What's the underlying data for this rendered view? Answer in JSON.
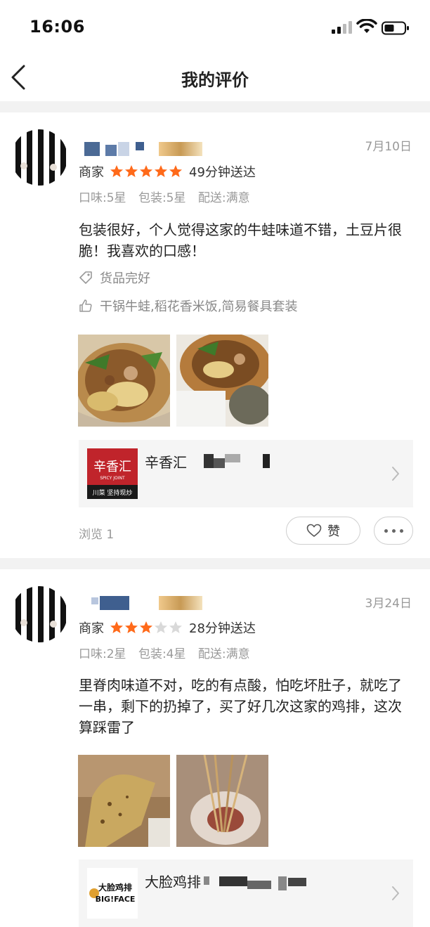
{
  "status_bar": {
    "time": "16:06"
  },
  "header": {
    "title": "我的评价"
  },
  "colors": {
    "star_active": "#ff6a1a",
    "star_inactive": "#d9d9d9"
  },
  "reviews": [
    {
      "date": "7月10日",
      "merchant_label": "商家",
      "rating": 5,
      "delivery": "49分钟送达",
      "sub_ratings": [
        "口味:5星",
        "包装:5星",
        "配送:满意"
      ],
      "content": "包装很好，个人觉得这家的牛蛙味道不错，土豆片很脆！我喜欢的口感！",
      "tags": [
        {
          "icon": "tag-icon",
          "text": "货品完好"
        },
        {
          "icon": "thumbs-up-icon",
          "text": "干锅牛蛙,稻花香米饭,简易餐具套装"
        }
      ],
      "shop": {
        "name": "辛香汇",
        "logo_main": "辛香汇",
        "logo_sub": "SPICY JOINT",
        "logo_bottom": "川菜 坚持现炒"
      },
      "views": "浏览 1",
      "like_label": "赞"
    },
    {
      "date": "3月24日",
      "merchant_label": "商家",
      "rating": 3,
      "delivery": "28分钟送达",
      "sub_ratings": [
        "口味:2星",
        "包装:4星",
        "配送:满意"
      ],
      "content": "里脊肉味道不对，吃的有点酸，怕吃坏肚子，就吃了一串，剩下的扔掉了，买了好几次这家的鸡排，这次算踩雷了",
      "shop": {
        "name": "大脸鸡排",
        "logo_main": "大脸鸡排",
        "logo_sub": "BIG!FACE"
      }
    }
  ]
}
